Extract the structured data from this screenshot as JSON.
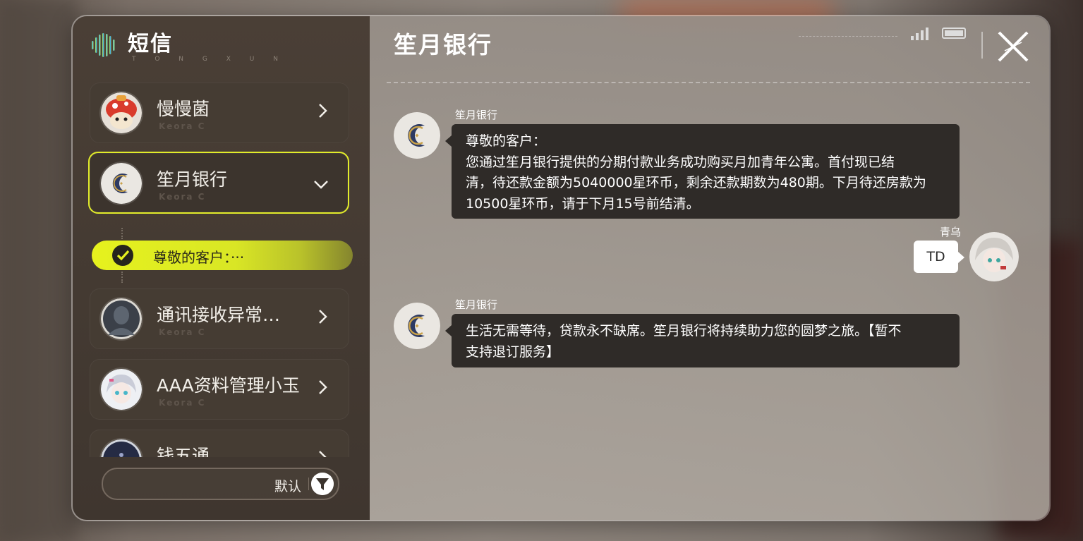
{
  "app": {
    "title": "短信",
    "subtitle": "T O N G X U N"
  },
  "contacts": [
    {
      "name": "慢慢菌",
      "tag": "Keora C"
    },
    {
      "name": "笙月银行",
      "tag": "Keora C"
    },
    {
      "name": "通讯接收异常…",
      "tag": "Keora C"
    },
    {
      "name": "AAA资料管理小玉",
      "tag": "Keora C"
    },
    {
      "name": "钱五通",
      "tag": ""
    }
  ],
  "active_subitem": {
    "text": "尊敬的客户：···"
  },
  "sort": {
    "label": "默认"
  },
  "chat": {
    "title": "笙月银行",
    "messages": [
      {
        "sender": "笙月银行",
        "lines": [
          "尊敬的客户：",
          "您通过笙月银行提供的分期付款业务成功购买月加青年公寓。首付现已结",
          "清，待还款金额为5040000星环币，剩余还款期数为480期。下月待还房款为",
          "10500星环币，请于下月15号前结清。"
        ]
      },
      {
        "sender": "青乌",
        "text": "TD"
      },
      {
        "sender": "笙月银行",
        "lines": [
          "生活无需等待，贷款永不缺席。笙月银行将持续助力您的圆梦之旅。【暂不",
          "支持退订服务】"
        ]
      }
    ]
  },
  "colors": {
    "accent": "#e2ec2a",
    "bubble_dark": "#2f2b28",
    "panel_left": "#433a32"
  },
  "icons": [
    "app-logo-icon",
    "chevron-right-icon",
    "chevron-down-icon",
    "check-icon",
    "filter-icon",
    "signal-icon",
    "battery-icon",
    "close-icon"
  ]
}
